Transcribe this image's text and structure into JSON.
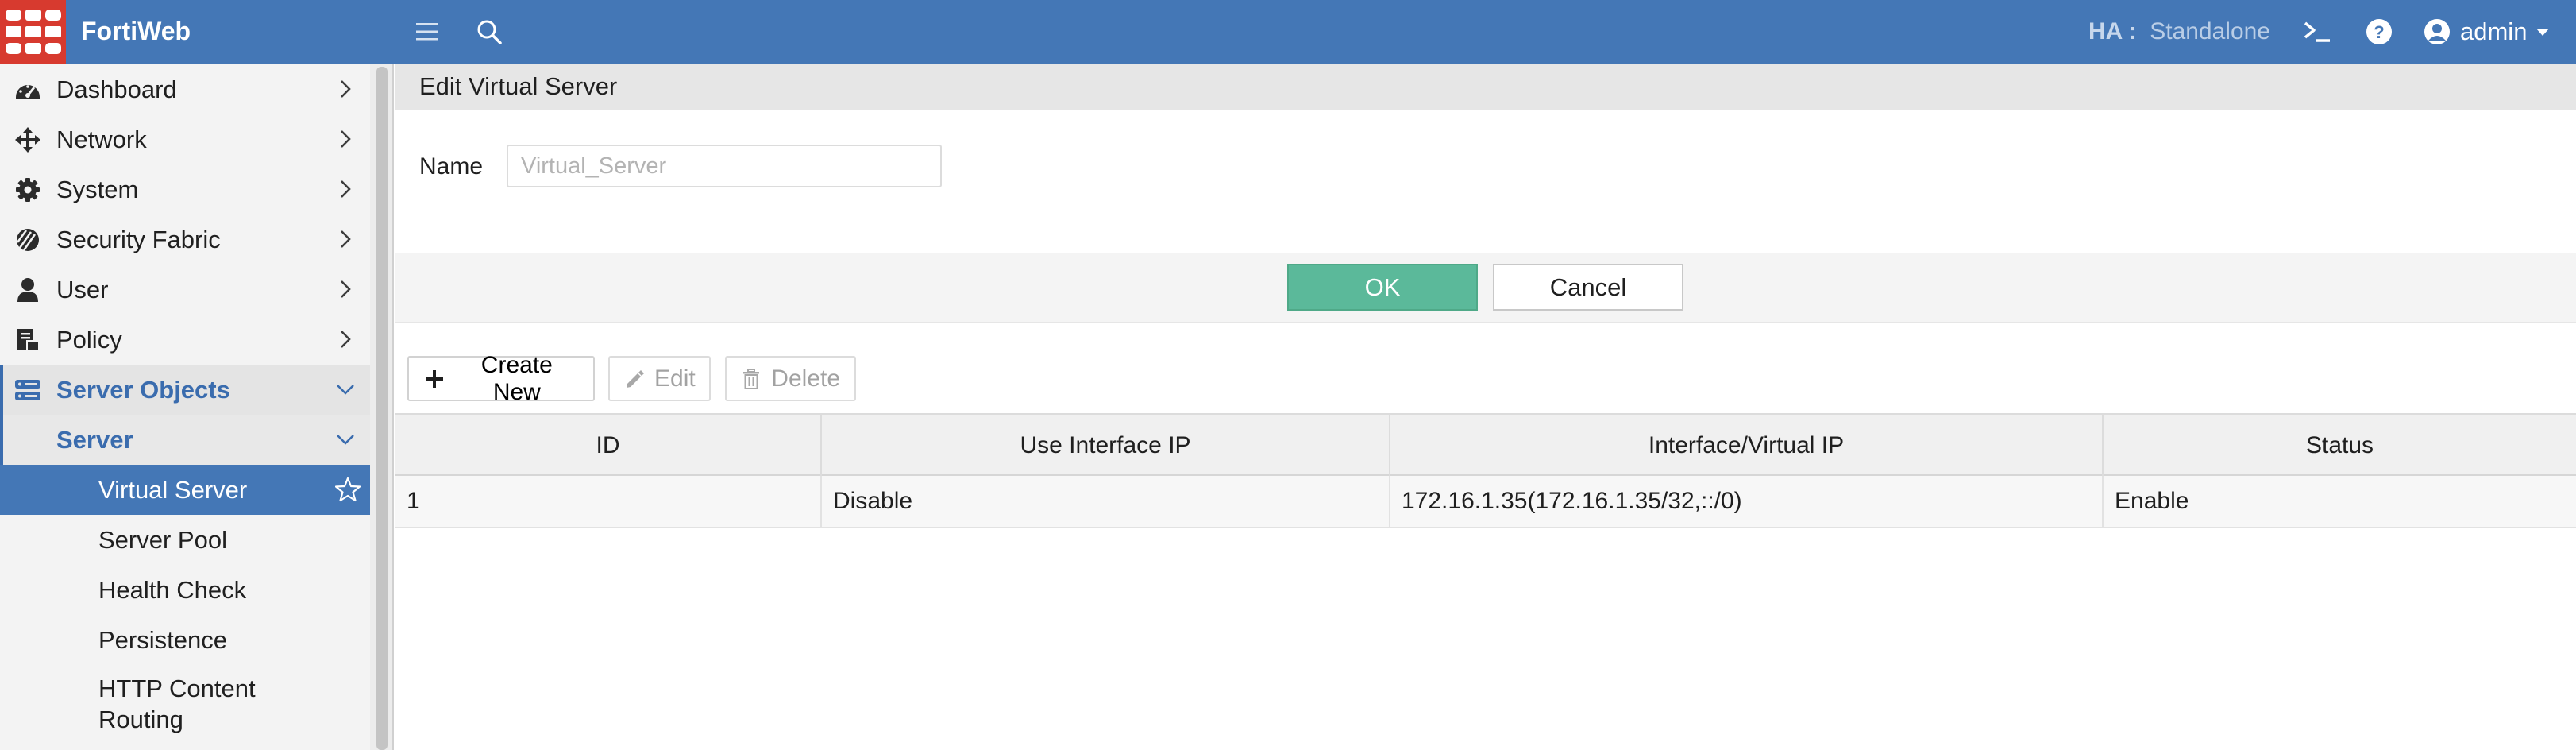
{
  "app": {
    "brand": "FortiWeb",
    "ha_label": "HA :",
    "ha_value": "Standalone",
    "user": "admin"
  },
  "icons": {
    "menu": "hamburger-menu-icon",
    "search": "search-icon",
    "cli": "terminal-prompt-icon",
    "help": "question-circle-icon",
    "user": "user-circle-icon",
    "favorite": "star-outline-icon"
  },
  "colors": {
    "topbar": "#4477b6",
    "logo": "#d73a2f",
    "accent": "#3a6cae",
    "ok_button": "#5bb99a"
  },
  "sidebar": {
    "items": [
      {
        "label": "Dashboard"
      },
      {
        "label": "Network"
      },
      {
        "label": "System"
      },
      {
        "label": "Security Fabric"
      },
      {
        "label": "User"
      },
      {
        "label": "Policy"
      },
      {
        "label": "Server Objects"
      },
      {
        "label": "Server"
      },
      {
        "label": "Virtual Server"
      },
      {
        "label": "Server Pool"
      },
      {
        "label": "Health Check"
      },
      {
        "label": "Persistence"
      },
      {
        "label": "HTTP Content Routing"
      }
    ]
  },
  "main": {
    "section_title": "Edit Virtual Server",
    "name_label": "Name",
    "name_value": "",
    "name_placeholder": "Virtual_Server",
    "ok_label": "OK",
    "cancel_label": "Cancel",
    "toolbar": {
      "create_label": "Create New",
      "edit_label": "Edit",
      "delete_label": "Delete"
    },
    "table": {
      "columns": [
        "ID",
        "Use Interface IP",
        "Interface/Virtual IP",
        "Status"
      ],
      "rows": [
        [
          "1",
          "Disable",
          "172.16.1.35(172.16.1.35/32,::/0)",
          "Enable"
        ]
      ]
    }
  }
}
